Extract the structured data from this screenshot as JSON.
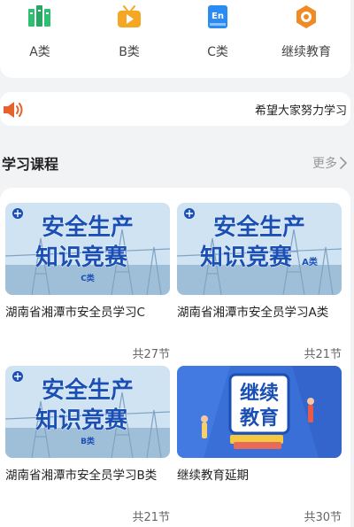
{
  "categories": [
    {
      "label": "A类",
      "icon": "books-icon",
      "color": "#2fbf71"
    },
    {
      "label": "B类",
      "icon": "video-play-icon",
      "color": "#f5a623"
    },
    {
      "label": "C类",
      "icon": "english-book-icon",
      "color": "#2a8bf2"
    },
    {
      "label": "继续教育",
      "icon": "education-badge-icon",
      "color": "#f08a24"
    }
  ],
  "notice": {
    "icon": "speaker-icon",
    "text": "希望大家努力学习"
  },
  "section": {
    "title": "学习课程",
    "more_label": "更多"
  },
  "courses": [
    {
      "banner_line1": "安全生产",
      "banner_line2": "知识竞赛",
      "tag": "C类",
      "title": "湖南省湘潭市安全员学习C",
      "count": "共27节"
    },
    {
      "banner_line1": "安全生产",
      "banner_line2": "知识竞赛",
      "tag": "A类",
      "title": "湖南省湘潭市安全员学习A类",
      "count": "共21节"
    },
    {
      "banner_line1": "安全生产",
      "banner_line2": "知识竞赛",
      "tag": "B类",
      "title": "湖南省湘潭市安全员学习B类",
      "count": "共21节"
    },
    {
      "banner_line1": "继续",
      "banner_line2": "教育",
      "tag": "",
      "title": "继续教育延期",
      "count": "共30节"
    }
  ],
  "colors": {
    "accent": "#1a4fb4",
    "banner_bg": "#cfe3f3",
    "edu_bg": "#3b6fd8",
    "speaker": "#e8602c"
  }
}
